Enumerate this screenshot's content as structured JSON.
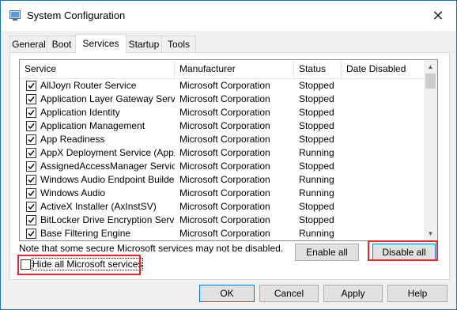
{
  "window": {
    "title": "System Configuration",
    "close_glyph": "✕"
  },
  "tabs": [
    {
      "label": "General"
    },
    {
      "label": "Boot"
    },
    {
      "label": "Services",
      "active": true
    },
    {
      "label": "Startup"
    },
    {
      "label": "Tools"
    }
  ],
  "list": {
    "columns": [
      "Service",
      "Manufacturer",
      "Status",
      "Date Disabled"
    ],
    "rows": [
      {
        "checked": true,
        "service": "AllJoyn Router Service",
        "manufacturer": "Microsoft Corporation",
        "status": "Stopped",
        "date_disabled": ""
      },
      {
        "checked": true,
        "service": "Application Layer Gateway Service",
        "manufacturer": "Microsoft Corporation",
        "status": "Stopped",
        "date_disabled": ""
      },
      {
        "checked": true,
        "service": "Application Identity",
        "manufacturer": "Microsoft Corporation",
        "status": "Stopped",
        "date_disabled": ""
      },
      {
        "checked": true,
        "service": "Application Management",
        "manufacturer": "Microsoft Corporation",
        "status": "Stopped",
        "date_disabled": ""
      },
      {
        "checked": true,
        "service": "App Readiness",
        "manufacturer": "Microsoft Corporation",
        "status": "Stopped",
        "date_disabled": ""
      },
      {
        "checked": true,
        "service": "AppX Deployment Service (AppX...",
        "manufacturer": "Microsoft Corporation",
        "status": "Running",
        "date_disabled": ""
      },
      {
        "checked": true,
        "service": "AssignedAccessManager Service",
        "manufacturer": "Microsoft Corporation",
        "status": "Stopped",
        "date_disabled": ""
      },
      {
        "checked": true,
        "service": "Windows Audio Endpoint Builder",
        "manufacturer": "Microsoft Corporation",
        "status": "Running",
        "date_disabled": ""
      },
      {
        "checked": true,
        "service": "Windows Audio",
        "manufacturer": "Microsoft Corporation",
        "status": "Running",
        "date_disabled": ""
      },
      {
        "checked": true,
        "service": "ActiveX Installer (AxInstSV)",
        "manufacturer": "Microsoft Corporation",
        "status": "Stopped",
        "date_disabled": ""
      },
      {
        "checked": true,
        "service": "BitLocker Drive Encryption Service",
        "manufacturer": "Microsoft Corporation",
        "status": "Stopped",
        "date_disabled": ""
      },
      {
        "checked": true,
        "service": "Base Filtering Engine",
        "manufacturer": "Microsoft Corporation",
        "status": "Running",
        "date_disabled": ""
      }
    ]
  },
  "note": "Note that some secure Microsoft services may not be disabled.",
  "buttons": {
    "enable_all": "Enable all",
    "disable_all": "Disable all",
    "ok": "OK",
    "cancel": "Cancel",
    "apply": "Apply",
    "help": "Help"
  },
  "hide_ms": {
    "label": "Hide all Microsoft services",
    "checked": false
  },
  "colors": {
    "highlight_red": "#e0282e",
    "primary_border": "#0078d7"
  }
}
